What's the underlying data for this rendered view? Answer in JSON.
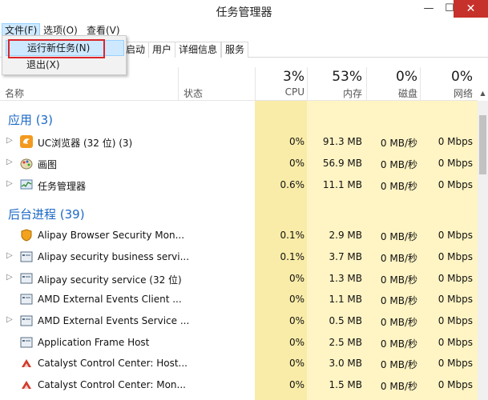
{
  "window": {
    "title": "任务管理器",
    "minimize": "—",
    "maximize": "☐",
    "close": "✕"
  },
  "menu": {
    "file": "文件(F)",
    "options": "选项(O)",
    "view": "查看(V)"
  },
  "file_menu": {
    "run_new_task": "运行新任务(N)",
    "exit": "退出(X)"
  },
  "tabs": {
    "startup": "启动",
    "users": "用户",
    "details": "详细信息",
    "services": "服务"
  },
  "columns": {
    "name": "名称",
    "status": "状态",
    "cpu_pct": "3%",
    "cpu": "CPU",
    "mem_pct": "53%",
    "mem": "内存",
    "disk_pct": "0%",
    "disk": "磁盘",
    "net_pct": "0%",
    "net": "网络"
  },
  "groups": {
    "apps": "应用 (3)",
    "background": "后台进程 (39)"
  },
  "apps": [
    {
      "name": "UC浏览器 (32 位) (3)",
      "cpu": "0%",
      "mem": "91.3 MB",
      "disk": "0 MB/秒",
      "net": "0 Mbps",
      "icon": "uc-browser-icon"
    },
    {
      "name": "画图",
      "cpu": "0%",
      "mem": "56.9 MB",
      "disk": "0 MB/秒",
      "net": "0 Mbps",
      "icon": "paint-icon"
    },
    {
      "name": "任务管理器",
      "cpu": "0.6%",
      "mem": "11.1 MB",
      "disk": "0 MB/秒",
      "net": "0 Mbps",
      "icon": "task-manager-icon"
    }
  ],
  "background": [
    {
      "name": "Alipay Browser Security Mon...",
      "cpu": "0.1%",
      "mem": "2.9 MB",
      "disk": "0 MB/秒",
      "net": "0 Mbps",
      "icon": "shield-icon"
    },
    {
      "name": "Alipay security business servi...",
      "cpu": "0.1%",
      "mem": "3.7 MB",
      "disk": "0 MB/秒",
      "net": "0 Mbps",
      "icon": "service-icon"
    },
    {
      "name": "Alipay security service (32 位)",
      "cpu": "0%",
      "mem": "1.3 MB",
      "disk": "0 MB/秒",
      "net": "0 Mbps",
      "icon": "service-icon"
    },
    {
      "name": "AMD External Events Client ...",
      "cpu": "0%",
      "mem": "1.1 MB",
      "disk": "0 MB/秒",
      "net": "0 Mbps",
      "icon": "service-icon"
    },
    {
      "name": "AMD External Events Service ...",
      "cpu": "0%",
      "mem": "0.5 MB",
      "disk": "0 MB/秒",
      "net": "0 Mbps",
      "icon": "service-icon"
    },
    {
      "name": "Application Frame Host",
      "cpu": "0%",
      "mem": "2.5 MB",
      "disk": "0 MB/秒",
      "net": "0 Mbps",
      "icon": "service-icon"
    },
    {
      "name": "Catalyst Control Center: Host...",
      "cpu": "0%",
      "mem": "3.0 MB",
      "disk": "0 MB/秒",
      "net": "0 Mbps",
      "icon": "catalyst-icon"
    },
    {
      "name": "Catalyst Control Center: Mon...",
      "cpu": "0%",
      "mem": "1.5 MB",
      "disk": "0 MB/秒",
      "net": "0 Mbps",
      "icon": "catalyst-icon"
    }
  ],
  "colors": {
    "accent": "#1c69c6",
    "highlight_box": "#d9262c",
    "usage_shade": "#fff4c4"
  }
}
